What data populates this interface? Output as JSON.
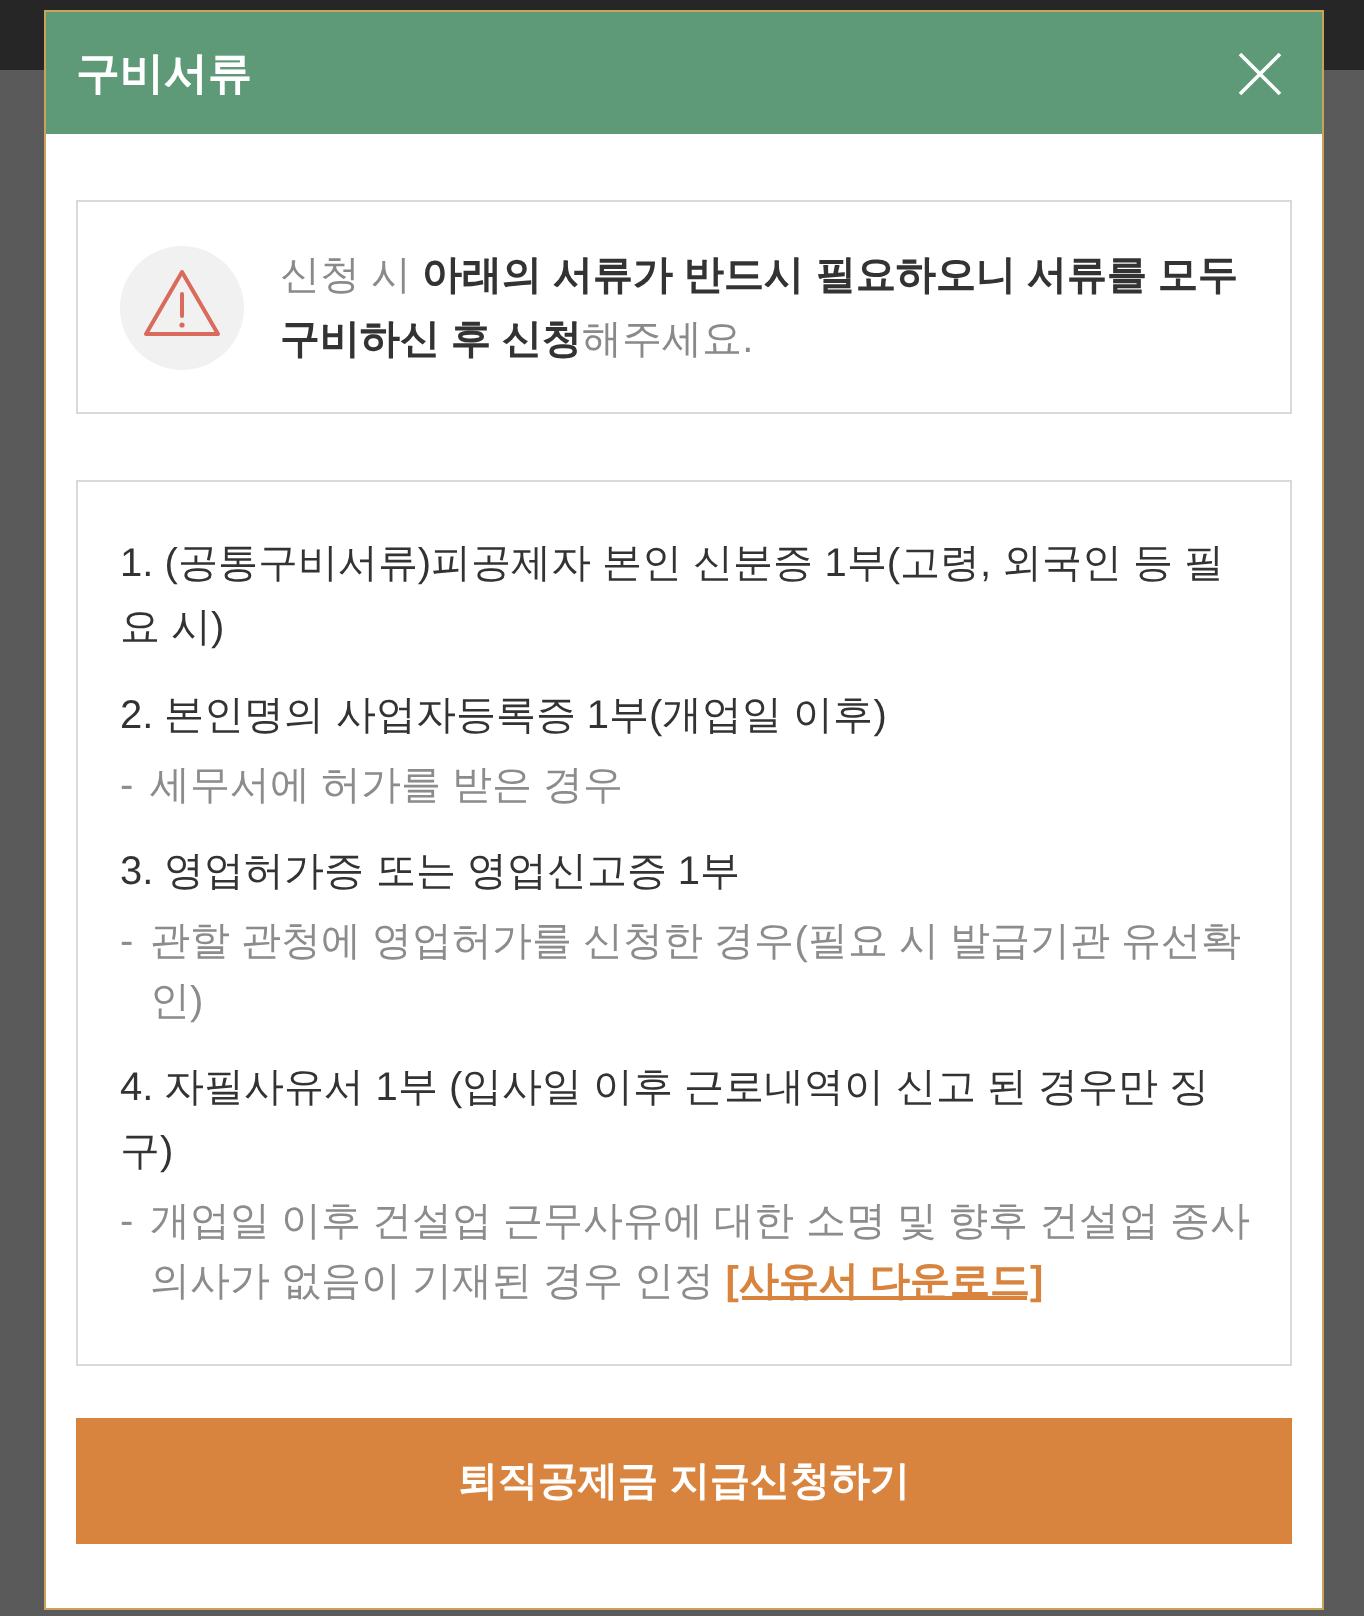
{
  "dialog": {
    "title": "구비서류"
  },
  "notice": {
    "text": "신청 시 **아래의 서류가 반드시 필요하오니 서류를 모두 구비하신 후 신청**해주세요."
  },
  "documents": [
    {
      "title": "1. (공통구비서류)피공제자 본인 신분증 1부(고령, 외국인 등 필요 시)"
    },
    {
      "title": "2. 본인명의 사업자등록증 1부(개업일 이후)",
      "notes": [
        {
          "bullet": "-",
          "text": "세무서에 허가를 받은 경우"
        }
      ]
    },
    {
      "title": "3. 영업허가증 또는 영업신고증 1부",
      "notes": [
        {
          "bullet": "-",
          "text": "관할 관청에 영업허가를 신청한 경우(필요 시 발급기관 유선확인)"
        }
      ]
    },
    {
      "title": "4. 자필사유서 1부 (입사일 이후 근로내역이 신고 된 경우만 징구)",
      "notes": [
        {
          "bullet": "-",
          "text": "개업일 이후 건설업 근무사유에 대한 소명 및 향후 건설업 종사 의사가 없음이 기재된 경우 인정",
          "link": "[사유서 다운로드]"
        }
      ]
    }
  ],
  "submit_button": {
    "label": "퇴직공제금 지급신청하기"
  }
}
